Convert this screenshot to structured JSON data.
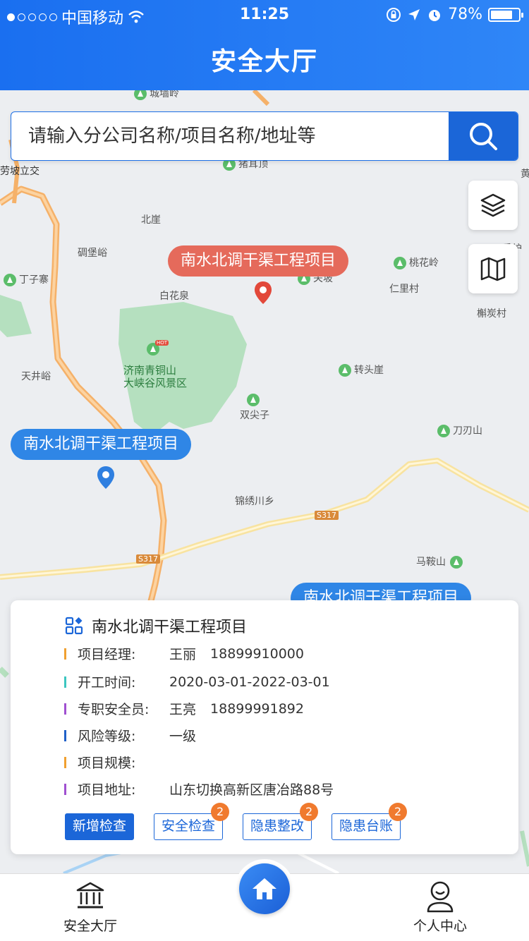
{
  "status_bar": {
    "carrier": "中国移动",
    "time": "11:25",
    "battery": "78%"
  },
  "header": {
    "title": "安全大厅"
  },
  "search": {
    "placeholder": "请输入分公司名称/项目名称/地址等"
  },
  "map": {
    "places": [
      "城墙岭",
      "猪耳顶",
      "劳坡立交",
      "北崖",
      "碉堡峪",
      "丁子寨",
      "白花泉",
      "关坡",
      "桃花岭",
      "仁里村",
      "香炉",
      "槲炭村",
      "济南青铜山",
      "大峡谷风景区",
      "HOT",
      "转头崖",
      "天井峪",
      "双尖子",
      "刀刃山",
      "锦绣川乡",
      "S317",
      "S317",
      "马鞍山",
      "黄"
    ],
    "bubbles": [
      "南水北调干渠工程项目",
      "南水北调干渠工程项目",
      "南水北调干渠工程项目"
    ]
  },
  "card": {
    "title": "南水北调干渠工程项目",
    "rows": [
      {
        "label": "项目经理:",
        "value": "王丽",
        "value2": "18899910000",
        "color": "#f0a030"
      },
      {
        "label": "开工时间:",
        "value": "2020-03-01-2022-03-01",
        "value2": "",
        "color": "#3cc6c0"
      },
      {
        "label": "专职安全员:",
        "value": "王亮",
        "value2": "18899991892",
        "color": "#a050d0"
      },
      {
        "label": "风险等级:",
        "value": "一级",
        "value2": "",
        "color": "#2060c8"
      },
      {
        "label": "项目规模:",
        "value": "",
        "value2": "",
        "color": "#f0a030"
      },
      {
        "label": "项目地址:",
        "value": "山东切换高新区唐冶路88号",
        "value2": "",
        "color": "#a050d0"
      }
    ],
    "buttons": [
      {
        "label": "新增检查",
        "badge": ""
      },
      {
        "label": "安全检查",
        "badge": "2"
      },
      {
        "label": "隐患整改",
        "badge": "2"
      },
      {
        "label": "隐患台账",
        "badge": "2"
      }
    ]
  },
  "tabbar": {
    "left": "安全大厅",
    "right": "个人中心"
  },
  "colors": {
    "primary": "#1b66d8",
    "header": "#1a6ff0",
    "badge": "#f07a2e"
  }
}
